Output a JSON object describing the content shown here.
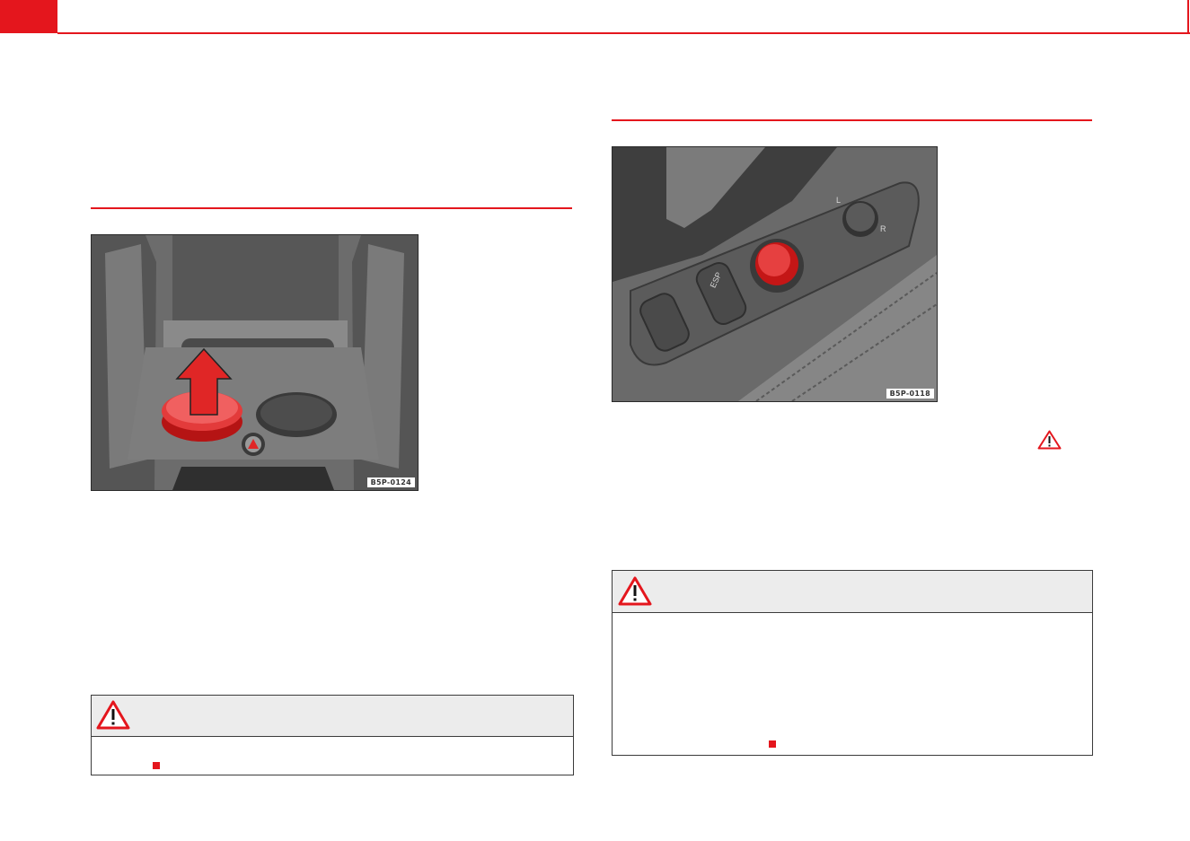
{
  "header": {
    "accent_color": "#e4161d"
  },
  "left_figure": {
    "code": "B5P-0124",
    "icon": "red-up-arrow-icon"
  },
  "right_figure": {
    "code": "B5P-0118",
    "buttons": [
      "key-lock-icon",
      "ESP",
      "hazard-icon",
      "mirror-adjust-icon"
    ],
    "esp_label": "ESP",
    "mirror_left": "L",
    "mirror_right": "R"
  },
  "left_warning": {
    "icon": "warning-triangle-icon"
  },
  "right_warning": {
    "icon": "warning-triangle-icon"
  },
  "inline_warning": {
    "icon": "warning-triangle-icon"
  },
  "end_marks": {
    "color": "#e4161d"
  }
}
